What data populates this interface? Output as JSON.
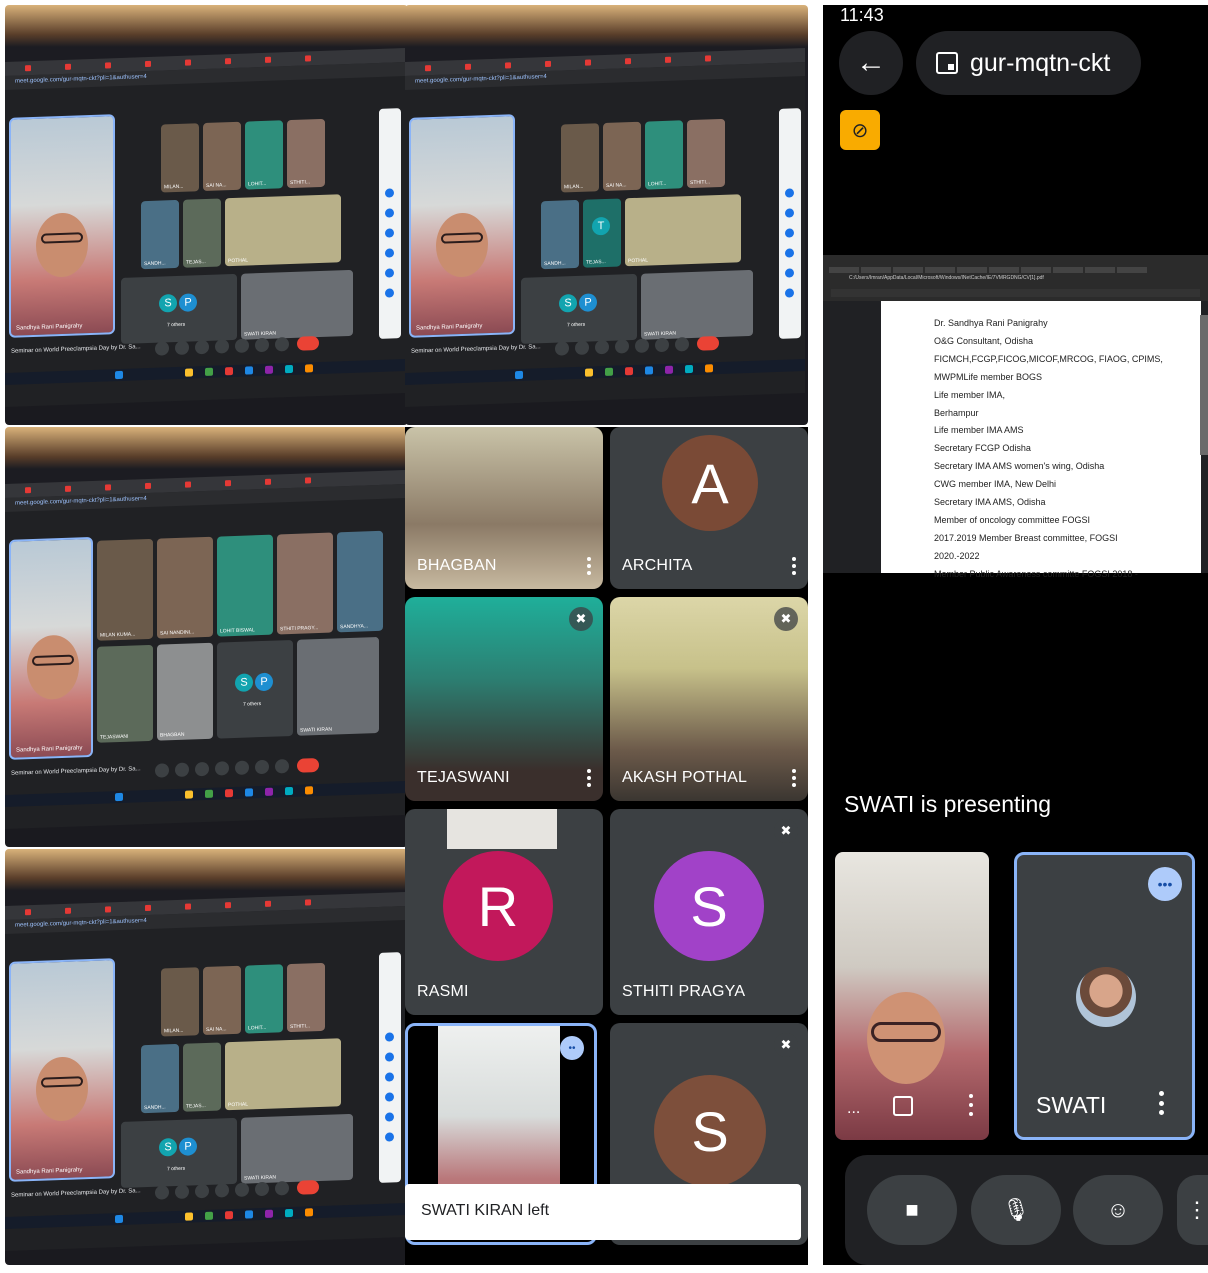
{
  "laptop_screens": {
    "url": "meet.google.com/gur-mqtn-ckt?pli=1&authuser=4",
    "presenter_name": "Sandhya Rani Panigrahy",
    "meeting_title": "Seminar on World Preeclampsia Day by Dr. Sa...",
    "others_label": "7 others",
    "others_avatars": [
      "S",
      "P"
    ],
    "tiles_row1": [
      "MILAN...",
      "SAI NA...",
      "LOHIT...",
      "STHITI..."
    ],
    "tiles_row2": [
      "SANDH...",
      "TEJAS...",
      "POTHAL"
    ],
    "tiles_row1_wide": [
      "MILAN KUMA...",
      "SAI NANDINI...",
      "LOHIT BISWAL",
      "STHITI PRAGY...",
      "SANDHYA..."
    ],
    "tiles_row2_wide": [
      "TEJASWANI",
      "BHAGBAN",
      "SWATI KIRAN"
    ],
    "swati_label": "SWATI KIRAN",
    "tile_t_avatar": "T"
  },
  "phone_grid": {
    "tiles": [
      {
        "name": "BHAGBAN"
      },
      {
        "name": "ARCHITA",
        "avatar": "A"
      },
      {
        "name": "TEJASWANI"
      },
      {
        "name": "AKASH POTHAL"
      },
      {
        "name": "RASMI",
        "avatar": "R"
      },
      {
        "name": "STHITI PRAGYA",
        "avatar": "S"
      },
      {
        "name": "",
        "avatar": "S"
      }
    ],
    "toast": "SWATI KIRAN left"
  },
  "phone": {
    "time": "11:43",
    "meeting_code": "gur-mqtn-ckt",
    "presenting_text": "SWATI is presenting",
    "speaker_name": "SWATI",
    "self_more": "...",
    "pdf_path": "C:/Users/Imran/AppData/Local/Microsoft/Windows/INetCache/IE/7VMRGDNG/CV[1].pdf",
    "pdf_lines": [
      "Dr. Sandhya Rani Panigrahy",
      "O&G Consultant, Odisha",
      "FICMCH,FCGP,FICOG,MICOF,MRCOG, FIAOG, CPIMS,",
      "MWPMLife member BOGS",
      "Life member IMA,",
      "Berhampur",
      "Life member IMA AMS",
      "Secretary FCGP Odisha",
      "Secretary IMA AMS women's wing, Odisha",
      "CWG member IMA, New Delhi",
      "Secretary IMA AMS, Odisha",
      "Member of oncology committee FOGSI",
      "2017.2019 Member Breast committee, FOGSI",
      "2020.-2022",
      "Member Public Awareness committe FOGSI 2018 -"
    ]
  },
  "colors": {
    "archita": "#7a4a36",
    "rasmi": "#c2185b",
    "sthiti": "#a142c8",
    "last_s": "#7d4f3b",
    "avatar_s": "#12a4af",
    "avatar_p": "#1e8fd1",
    "accent": "#8ab4f8",
    "end_call": "#ea4335",
    "novideo_badge": "#f9ab00"
  },
  "icons": [
    "back-arrow-icon",
    "calendar-icon",
    "video-off-icon",
    "mic-off-icon",
    "more-vert-icon",
    "pin-icon",
    "speaking-icon",
    "camera-icon",
    "mic-icon",
    "emoji-icon"
  ]
}
